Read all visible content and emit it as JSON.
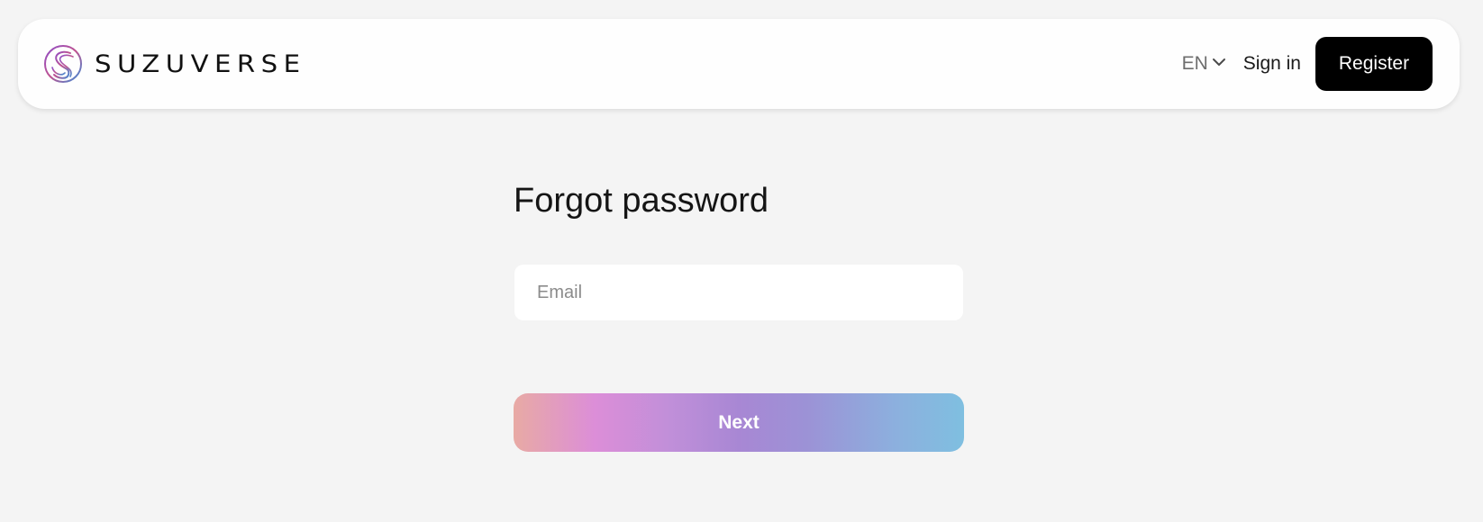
{
  "header": {
    "brand_name": "SUZUVERSE",
    "logo_icon": "suzuverse-s-logo-icon",
    "language": "EN",
    "language_icon": "chevron-down-icon",
    "sign_in_label": "Sign in",
    "register_label": "Register"
  },
  "form": {
    "title": "Forgot password",
    "email_placeholder": "Email",
    "email_value": "",
    "next_label": "Next"
  },
  "colors": {
    "background": "#f4f4f4",
    "header_background": "#fefefe",
    "register_background": "#000000",
    "next_gradient": [
      "#e8aaa4",
      "#dc8ed8",
      "#a887d4",
      "#7fbfe0"
    ]
  }
}
